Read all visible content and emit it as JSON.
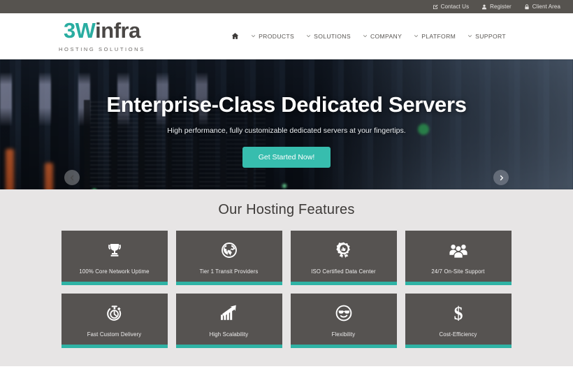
{
  "topbar": {
    "items": [
      {
        "label": "Contact Us",
        "icon": "pencil-square-icon"
      },
      {
        "label": "Register",
        "icon": "user-icon"
      },
      {
        "label": "Client Area",
        "icon": "lock-icon"
      }
    ]
  },
  "header": {
    "logo": {
      "part1": "3W",
      "part2": "infra",
      "tagline": "HOSTING SOLUTIONS"
    },
    "home_icon": "home-icon",
    "nav": [
      {
        "label": "PRODUCTS",
        "icon": "chevron-down-icon"
      },
      {
        "label": "SOLUTIONS",
        "icon": "chevron-down-icon"
      },
      {
        "label": "COMPANY",
        "icon": "chevron-down-icon"
      },
      {
        "label": "PLATFORM",
        "icon": "chevron-down-icon"
      },
      {
        "label": "SUPPORT",
        "icon": "chevron-down-icon"
      }
    ]
  },
  "hero": {
    "title": "Enterprise-Class Dedicated Servers",
    "subtitle": "High performance, fully customizable dedicated servers at your fingertips.",
    "cta": "Get Started Now!",
    "prev_icon": "chevron-left-icon",
    "next_icon": "chevron-right-icon",
    "slides": 2,
    "active_slide": 1
  },
  "features": {
    "title": "Our Hosting Features",
    "accent_color": "#2fb3a5",
    "card_color": "#565351",
    "cards": [
      {
        "label": "100% Core Network Uptime",
        "icon": "trophy-icon"
      },
      {
        "label": "Tier 1 Transit Providers",
        "icon": "globe-icon"
      },
      {
        "label": "ISO Certified Data Center",
        "icon": "award-badge-icon"
      },
      {
        "label": "24/7 On-Site Support",
        "icon": "users-group-icon"
      },
      {
        "label": "Fast Custom Delivery",
        "icon": "stopwatch-icon"
      },
      {
        "label": "High Scalability",
        "icon": "growth-chart-icon"
      },
      {
        "label": "Flexibility",
        "icon": "cool-face-icon"
      },
      {
        "label": "Cost-Efficiency",
        "icon": "dollar-sign-icon"
      }
    ]
  }
}
